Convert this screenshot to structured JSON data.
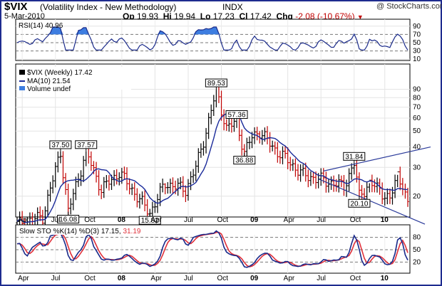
{
  "header": {
    "symbol": "$VIX",
    "full_name": "(Volatility Index - New Methodology)",
    "exchange": "INDX",
    "watermark": "@ StockCharts.com",
    "date": "5-Mar-2010",
    "open_label": "Op",
    "open": "19.93",
    "high_label": "Hi",
    "high": "19.94",
    "low_label": "Lo",
    "low": "17.23",
    "close_label": "Cl",
    "close": "17.42",
    "change_label": "Chg",
    "change": "-2.08 (-10.67%)"
  },
  "rsi_panel": {
    "legend": "RSI(14) 40.96",
    "scale": [
      "90",
      "70",
      "50",
      "30",
      "10"
    ],
    "overbought": 70,
    "oversold": 30
  },
  "price_panel": {
    "legend_main": "$VIX (Weekly) 17.42",
    "legend_ma": "MA(10) 21.54",
    "legend_vol": "Volume undef",
    "scale": [
      "90",
      "80",
      "70",
      "60",
      "50",
      "40",
      "30",
      "20"
    ],
    "callouts": [
      "37.50",
      "16.08",
      "37.57",
      "15.82",
      "89.53",
      "57.36",
      "36.88",
      "31.84",
      "20.10"
    ]
  },
  "sto_panel": {
    "legend_prefix": "Slow STO %K(14) %D(3) 17.15,",
    "legend_d": "31.19",
    "scale": [
      "80",
      "50",
      "20"
    ]
  },
  "x_axis": {
    "labels": [
      "Apr",
      "Jul",
      "Oct",
      "08",
      "Apr",
      "Jul",
      "Oct",
      "09",
      "Apr",
      "Jul",
      "Oct",
      "10"
    ]
  },
  "colors": {
    "frame": "#1e2b8f",
    "rsi_line": "#1a2a8a",
    "rsi_fill": "#3d7de0",
    "up_bar": "#000000",
    "down_bar": "#c00000",
    "ma_line": "#1a2a9a",
    "k_line": "#1a2a8a",
    "d_line": "#e0303a",
    "trend_line": "#2a3a9a",
    "change": "#c00000"
  },
  "chart_data": {
    "type": "line",
    "title": "$VIX (Volatility Index - New Methodology) INDX",
    "subtitle": "$VIX (Weekly) 17.42",
    "x": [
      "Apr 2007",
      "Jul 2007",
      "Oct 2007",
      "Jan 2008",
      "Apr 2008",
      "Jul 2008",
      "Oct 2008",
      "Jan 2009",
      "Apr 2009",
      "Jul 2009",
      "Oct 2009",
      "Jan 2010",
      "Mar 2010"
    ],
    "series": [
      {
        "name": "$VIX (Weekly) 17.42",
        "values": [
          13.5,
          24.0,
          20.0,
          24.5,
          20.5,
          22.5,
          62.0,
          44.0,
          36.0,
          26.0,
          23.0,
          21.0,
          17.4
        ]
      },
      {
        "name": "MA(10) 21.54",
        "values": [
          13.0,
          18.0,
          22.0,
          23.0,
          22.0,
          21.5,
          45.0,
          52.0,
          38.0,
          27.5,
          24.5,
          22.0,
          21.5
        ]
      }
    ],
    "annotations": [
      {
        "label": "37.50",
        "x": "Aug 2007",
        "y": 37.5
      },
      {
        "label": "16.08",
        "x": "Sep 2007",
        "y": 16.08
      },
      {
        "label": "37.57",
        "x": "Nov 2007",
        "y": 37.57
      },
      {
        "label": "15.82",
        "x": "May 2008",
        "y": 15.82
      },
      {
        "label": "89.53",
        "x": "Oct 2008",
        "y": 89.53
      },
      {
        "label": "57.36",
        "x": "Dec 2008",
        "y": 57.36
      },
      {
        "label": "36.88",
        "x": "Dec 2008",
        "y": 36.88
      },
      {
        "label": "31.84",
        "x": "Oct 2009",
        "y": 31.84
      },
      {
        "label": "20.10",
        "x": "Oct 2009",
        "y": 20.1
      }
    ],
    "scale": "log",
    "ylim": [
      12,
      100
    ],
    "grid": true,
    "legend_position": "top-left"
  }
}
